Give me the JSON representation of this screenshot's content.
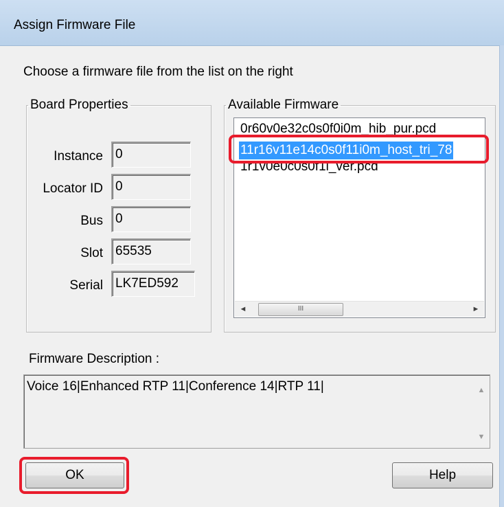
{
  "window": {
    "title": "Assign Firmware File"
  },
  "instruction": "Choose a firmware file from the list on the right",
  "board_properties": {
    "legend": "Board Properties",
    "fields": [
      {
        "label": "Instance",
        "value": "0"
      },
      {
        "label": "Locator ID",
        "value": "0"
      },
      {
        "label": "Bus",
        "value": "0"
      },
      {
        "label": "Slot",
        "value": "65535"
      },
      {
        "label": "Serial",
        "value": "LK7ED592"
      }
    ]
  },
  "available_firmware": {
    "legend": "Available Firmware",
    "items": [
      {
        "text": "0r60v0e32c0s0f0i0m_hib_pur.pcd",
        "selected": false
      },
      {
        "text": "11r16v11e14c0s0f11i0m_host_tri_78",
        "selected": true
      },
      {
        "text": "1r1v0e0c0s0f1i_ver.pcd",
        "selected": false
      }
    ],
    "scroll_left": "◄",
    "scroll_right": "►",
    "thumb_grip": "III"
  },
  "firmware_description": {
    "label": "Firmware Description :",
    "text": "Voice 16|Enhanced RTP 11|Conference 14|RTP 11|",
    "scroll_up": "▲",
    "scroll_down": "▼"
  },
  "buttons": {
    "ok": "OK",
    "help": "Help"
  },
  "colors": {
    "highlight": "#e81c2c",
    "selection": "#3399ff"
  }
}
